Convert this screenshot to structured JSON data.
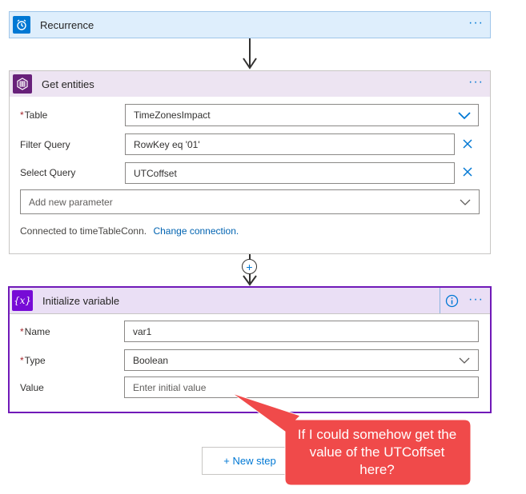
{
  "recurrence": {
    "title": "Recurrence",
    "icon": "alarm-clock-icon",
    "color": "#0078d4",
    "header_bg": "#deeefc"
  },
  "get_entities": {
    "title": "Get entities",
    "icon": "table-storage-icon",
    "color": "#68217a",
    "header_bg": "#ede4f2",
    "fields": {
      "table": {
        "label": "Table",
        "required": "*",
        "value": "TimeZonesImpact"
      },
      "filter_query": {
        "label": "Filter Query",
        "value": "RowKey eq '01'"
      },
      "select_query": {
        "label": "Select Query",
        "value": "UTCoffset"
      },
      "add_param": {
        "placeholder": "Add new parameter"
      }
    },
    "connection_text": "Connected to timeTableConn.",
    "change_connection": "Change connection."
  },
  "init_variable": {
    "title": "Initialize variable",
    "icon": "variable-icon",
    "icon_text": "{x}",
    "color": "#770bd6",
    "header_bg": "#eadff5",
    "info_icon": "info-icon",
    "fields": {
      "name": {
        "label": "Name",
        "required": "*",
        "value": "var1"
      },
      "type": {
        "label": "Type",
        "required": "*",
        "value": "Boolean"
      },
      "value": {
        "label": "Value",
        "placeholder": "Enter initial value"
      }
    }
  },
  "new_step": {
    "label": "+ New step"
  },
  "callout": {
    "text": "If I could somehow get the value of the UTCoffset here?",
    "color": "#f04a4a"
  },
  "more_icon": "ellipsis-icon",
  "chevron_icon": "chevron-down-icon",
  "clear_icon": "close-icon"
}
